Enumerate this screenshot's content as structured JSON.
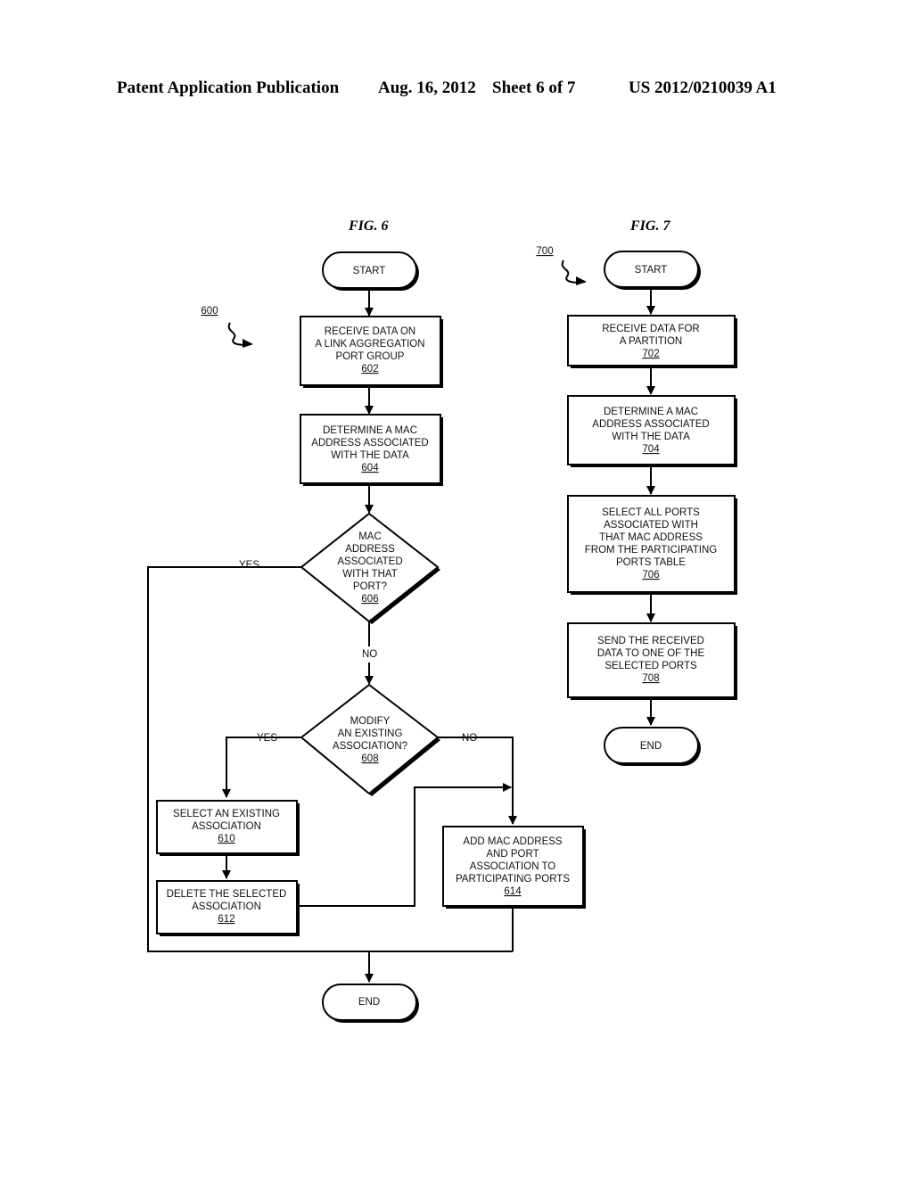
{
  "header": {
    "publication": "Patent Application Publication",
    "date": "Aug. 16, 2012",
    "sheet": "Sheet 6 of 7",
    "number": "US 2012/0210039 A1"
  },
  "fig6": {
    "title": "FIG. 6",
    "ref": "600",
    "start": "START",
    "end": "END",
    "steps": {
      "s602": {
        "lines": [
          "RECEIVE DATA ON",
          "A LINK AGGREGATION",
          "PORT GROUP"
        ],
        "ref": "602"
      },
      "s604": {
        "lines": [
          "DETERMINE A MAC",
          "ADDRESS ASSOCIATED",
          "WITH THE DATA"
        ],
        "ref": "604"
      },
      "s606": {
        "lines": [
          "MAC",
          "ADDRESS",
          "ASSOCIATED",
          "WITH THAT",
          "PORT?"
        ],
        "ref": "606"
      },
      "s608": {
        "lines": [
          "MODIFY",
          "AN EXISTING",
          "ASSOCIATION?"
        ],
        "ref": "608"
      },
      "s610": {
        "lines": [
          "SELECT AN EXISTING",
          "ASSOCIATION"
        ],
        "ref": "610"
      },
      "s612": {
        "lines": [
          "DELETE THE SELECTED",
          "ASSOCIATION"
        ],
        "ref": "612"
      },
      "s614": {
        "lines": [
          "ADD MAC ADDRESS",
          "AND PORT",
          "ASSOCIATION TO",
          "PARTICIPATING PORTS"
        ],
        "ref": "614"
      }
    },
    "labels": {
      "d606_yes": "YES",
      "d606_no": "NO",
      "d608_yes": "YES",
      "d608_no": "NO"
    }
  },
  "fig7": {
    "title": "FIG. 7",
    "ref": "700",
    "start": "START",
    "end": "END",
    "steps": {
      "s702": {
        "lines": [
          "RECEIVE DATA FOR",
          "A PARTITION"
        ],
        "ref": "702"
      },
      "s704": {
        "lines": [
          "DETERMINE A MAC",
          "ADDRESS ASSOCIATED",
          "WITH THE DATA"
        ],
        "ref": "704"
      },
      "s706": {
        "lines": [
          "SELECT ALL PORTS",
          "ASSOCIATED WITH",
          "THAT MAC ADDRESS",
          "FROM THE PARTICIPATING",
          "PORTS TABLE"
        ],
        "ref": "706"
      },
      "s708": {
        "lines": [
          "SEND THE RECEIVED",
          "DATA TO ONE OF THE",
          "SELECTED PORTS"
        ],
        "ref": "708"
      }
    }
  }
}
